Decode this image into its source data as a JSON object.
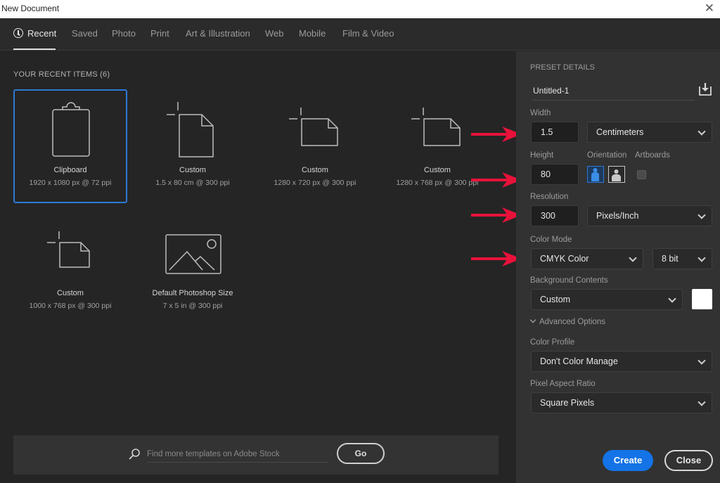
{
  "window": {
    "title": "New Document",
    "close_glyph": "✕"
  },
  "tabs": [
    {
      "label": "Recent",
      "active": true,
      "icon": "clock-icon"
    },
    {
      "label": "Saved"
    },
    {
      "label": "Photo"
    },
    {
      "label": "Print"
    },
    {
      "label": "Art & Illustration"
    },
    {
      "label": "Web"
    },
    {
      "label": "Mobile"
    },
    {
      "label": "Film & Video"
    }
  ],
  "recent": {
    "heading": "YOUR RECENT ITEMS  (6)",
    "items": [
      {
        "name": "Clipboard",
        "meta": "1920 x 1080 px @ 72 ppi",
        "icon": "clipboard-icon",
        "selected": true
      },
      {
        "name": "Custom",
        "meta": "1.5 x 80 cm @ 300 ppi",
        "icon": "portrait-document-icon"
      },
      {
        "name": "Custom",
        "meta": "1280 x 720 px @ 300 ppi",
        "icon": "landscape-document-icon"
      },
      {
        "name": "Custom",
        "meta": "1280 x 768 px @ 300 ppi",
        "icon": "landscape-document-icon"
      },
      {
        "name": "Custom",
        "meta": "1000 x 768 px @ 300 ppi",
        "icon": "landscape-document-icon"
      },
      {
        "name": "Default Photoshop Size",
        "meta": "7 x 5 in @ 300 ppi",
        "icon": "image-icon"
      }
    ]
  },
  "stock": {
    "placeholder": "Find more templates on Adobe Stock",
    "go_label": "Go"
  },
  "preset": {
    "heading": "PRESET DETAILS",
    "doc_name": "Untitled-1",
    "width_label": "Width",
    "width_value": "1.5",
    "width_unit": "Centimeters",
    "height_label": "Height",
    "height_value": "80",
    "orientation_label": "Orientation",
    "orientation": "portrait",
    "artboards_label": "Artboards",
    "artboards_checked": false,
    "resolution_label": "Resolution",
    "resolution_value": "300",
    "resolution_unit": "Pixels/Inch",
    "color_mode_label": "Color Mode",
    "color_mode": "CMYK Color",
    "bit_depth": "8 bit",
    "background_label": "Background Contents",
    "background": "Custom",
    "background_color": "#ffffff",
    "advanced_label": "Advanced Options",
    "color_profile_label": "Color Profile",
    "color_profile": "Don't Color Manage",
    "pixel_aspect_label": "Pixel Aspect Ratio",
    "pixel_aspect": "Square Pixels",
    "create_label": "Create",
    "close_label": "Close"
  },
  "annotations": {
    "arrow_color": "#e8123a",
    "arrow_count": 4
  },
  "colors": {
    "accent": "#1473e6",
    "selection": "#2c7ad6"
  }
}
